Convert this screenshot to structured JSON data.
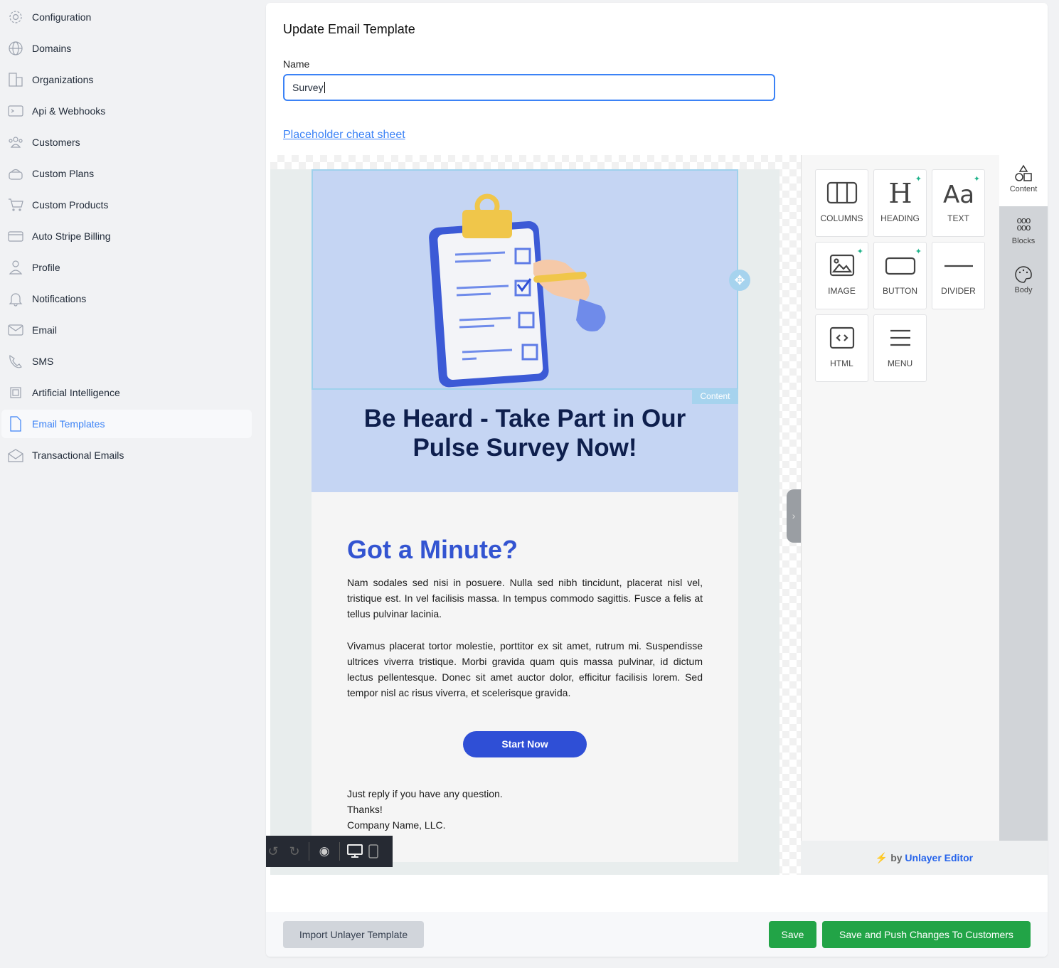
{
  "sidebar": {
    "items": [
      {
        "label": "Configuration",
        "icon": "gear-icon"
      },
      {
        "label": "Domains",
        "icon": "globe-icon"
      },
      {
        "label": "Organizations",
        "icon": "building-icon"
      },
      {
        "label": "Api & Webhooks",
        "icon": "terminal-icon"
      },
      {
        "label": "Customers",
        "icon": "users-icon"
      },
      {
        "label": "Custom Plans",
        "icon": "stack-icon"
      },
      {
        "label": "Custom Products",
        "icon": "cart-icon"
      },
      {
        "label": "Auto Stripe Billing",
        "icon": "credit-card-icon"
      },
      {
        "label": "Profile",
        "icon": "user-icon"
      },
      {
        "label": "Notifications",
        "icon": "bell-icon"
      },
      {
        "label": "Email",
        "icon": "envelope-icon"
      },
      {
        "label": "SMS",
        "icon": "phone-icon"
      },
      {
        "label": "Artificial Intelligence",
        "icon": "chip-icon"
      },
      {
        "label": "Email Templates",
        "icon": "document-icon",
        "active": true
      },
      {
        "label": "Transactional Emails",
        "icon": "envelope-open-icon"
      }
    ]
  },
  "form": {
    "title": "Update Email Template",
    "name_label": "Name",
    "name_value": "Survey",
    "cheat_sheet_link": "Placeholder cheat sheet"
  },
  "email": {
    "hero_heading": "Be Heard - Take Part in Our Pulse Survey Now!",
    "content_badge": "Content",
    "subheading": "Got a Minute?",
    "paragraph1": "Nam sodales sed nisi in posuere. Nulla sed nibh tincidunt, placerat nisl vel, tristique est. In vel facilisis massa. In tempus commodo sagittis. Fusce a felis at tellus pulvinar lacinia.",
    "paragraph2": "Vivamus placerat tortor molestie, porttitor ex sit amet, rutrum mi. Suspendisse ultrices viverra tristique. Morbi gravida quam quis massa pulvinar, id dictum lectus pellentesque. Donec sit amet auctor dolor, efficitur facilisis lorem. Sed tempor nisl ac risus viverra, et scelerisque gravida.",
    "cta": "Start Now",
    "sign1": "Just reply if you have any question.",
    "sign2": "Thanks!",
    "sign3": "Company Name, LLC."
  },
  "tools": [
    {
      "label": "COLUMNS",
      "icon": "columns-icon"
    },
    {
      "label": "HEADING",
      "icon": "heading-icon",
      "ai": true
    },
    {
      "label": "TEXT",
      "icon": "text-icon",
      "ai": true
    },
    {
      "label": "IMAGE",
      "icon": "image-icon",
      "ai": true
    },
    {
      "label": "BUTTON",
      "icon": "button-icon",
      "ai": true
    },
    {
      "label": "DIVIDER",
      "icon": "divider-icon"
    },
    {
      "label": "HTML",
      "icon": "code-icon"
    },
    {
      "label": "MENU",
      "icon": "menu-icon"
    }
  ],
  "tabs": [
    {
      "label": "Content",
      "active": true
    },
    {
      "label": "Blocks"
    },
    {
      "label": "Body"
    }
  ],
  "branding": {
    "prefix": "by",
    "name": "Unlayer Editor"
  },
  "footer": {
    "import": "Import Unlayer Template",
    "save": "Save",
    "save_push": "Save and Push Changes To Customers"
  },
  "colors": {
    "accent": "#3b82f6",
    "green": "#22a447",
    "hero_bg": "#c5d5f3",
    "navy": "#0e1f4d",
    "cta": "#2f4fd6"
  }
}
